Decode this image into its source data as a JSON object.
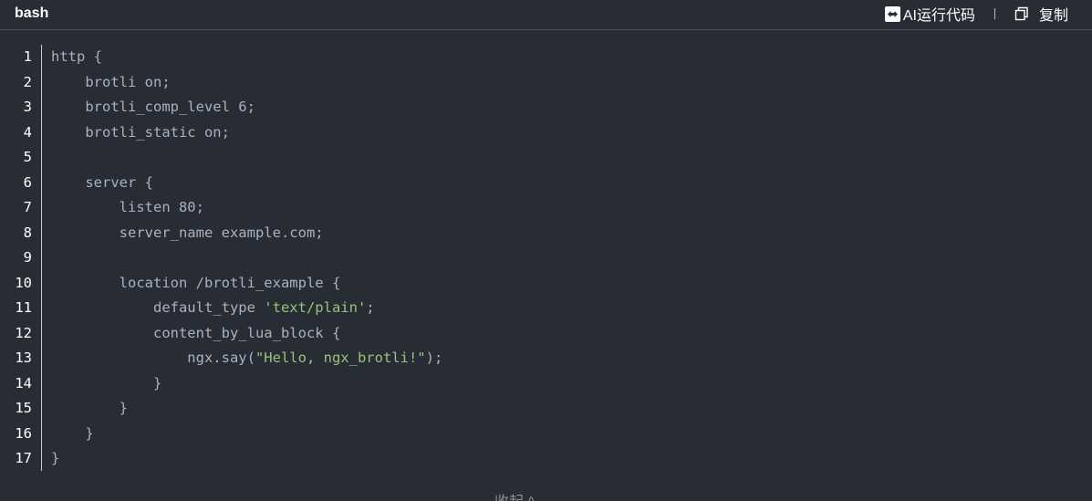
{
  "header": {
    "language": "bash",
    "ai_run_label": "AI运行代码",
    "copy_label": "复制"
  },
  "code": {
    "lines": [
      {
        "number": "1",
        "segments": [
          {
            "text": "http {",
            "type": "plain"
          }
        ]
      },
      {
        "number": "2",
        "segments": [
          {
            "text": "    brotli on;",
            "type": "plain"
          }
        ]
      },
      {
        "number": "3",
        "segments": [
          {
            "text": "    brotli_comp_level 6;",
            "type": "plain"
          }
        ]
      },
      {
        "number": "4",
        "segments": [
          {
            "text": "    brotli_static on;",
            "type": "plain"
          }
        ]
      },
      {
        "number": "5",
        "segments": [
          {
            "text": "",
            "type": "plain"
          }
        ]
      },
      {
        "number": "6",
        "segments": [
          {
            "text": "    server {",
            "type": "plain"
          }
        ]
      },
      {
        "number": "7",
        "segments": [
          {
            "text": "        listen 80;",
            "type": "plain"
          }
        ]
      },
      {
        "number": "8",
        "segments": [
          {
            "text": "        server_name example.com;",
            "type": "plain"
          }
        ]
      },
      {
        "number": "9",
        "segments": [
          {
            "text": "",
            "type": "plain"
          }
        ]
      },
      {
        "number": "10",
        "segments": [
          {
            "text": "        location /brotli_example {",
            "type": "plain"
          }
        ]
      },
      {
        "number": "11",
        "segments": [
          {
            "text": "            default_type ",
            "type": "plain"
          },
          {
            "text": "'text/plain'",
            "type": "string"
          },
          {
            "text": ";",
            "type": "plain"
          }
        ]
      },
      {
        "number": "12",
        "segments": [
          {
            "text": "            content_by_lua_block {",
            "type": "plain"
          }
        ]
      },
      {
        "number": "13",
        "segments": [
          {
            "text": "                ngx.say(",
            "type": "plain"
          },
          {
            "text": "\"Hello, ngx_brotli!\"",
            "type": "string"
          },
          {
            "text": ");",
            "type": "plain"
          }
        ]
      },
      {
        "number": "14",
        "segments": [
          {
            "text": "            }",
            "type": "plain"
          }
        ]
      },
      {
        "number": "15",
        "segments": [
          {
            "text": "        }",
            "type": "plain"
          }
        ]
      },
      {
        "number": "16",
        "segments": [
          {
            "text": "    }",
            "type": "plain"
          }
        ]
      },
      {
        "number": "17",
        "segments": [
          {
            "text": "}",
            "type": "plain"
          }
        ]
      }
    ]
  },
  "footer": {
    "collapse_label": "收起 ^"
  },
  "colors": {
    "background": "#282c34",
    "text": "#abb2bf",
    "string": "#98c379",
    "line_number": "#ffffff"
  },
  "icons": {
    "ai_run": "ai-run-icon",
    "copy": "copy-icon"
  }
}
